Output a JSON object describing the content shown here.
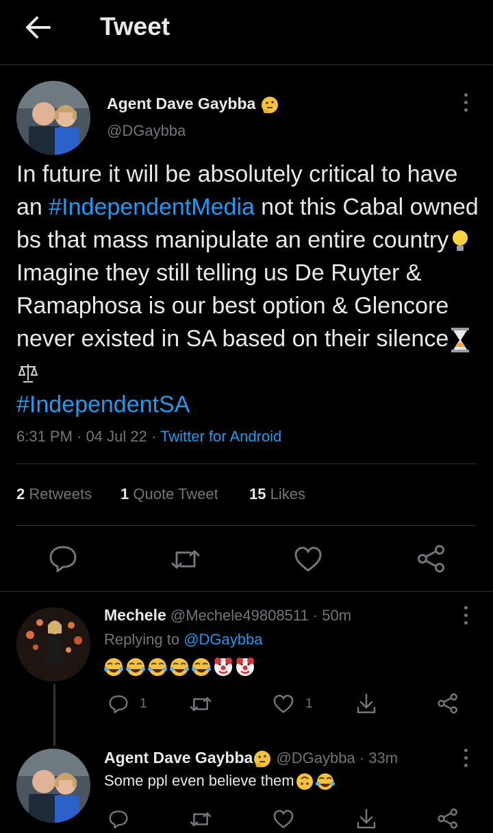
{
  "header": {
    "title": "Tweet"
  },
  "tweet": {
    "author_name": "Agent Dave Gaybba",
    "author_handle": "@DGaybba",
    "text_1": "In future it will be absolutely critical to have an ",
    "hashtag_1": "#IndependentMedia",
    "text_2": " not this Cabal owned bs that mass manipulate an entire country",
    "text_3": " Imagine they still telling us De Ruyter & Ramaphosa is our best option & Glencore never existed in SA based on their silence",
    "hashtag_2": "#IndependentSA",
    "time": "6:31 PM",
    "date": "04 Jul 22",
    "source": "Twitter for Android",
    "retweets_count": "2",
    "retweets_label": "Retweets",
    "quotes_count": "1",
    "quotes_label": "Quote Tweet",
    "likes_count": "15",
    "likes_label": "Likes"
  },
  "replies": [
    {
      "name": "Mechele",
      "handle": "@Mechele49808511",
      "time": "50m",
      "replying_to_label": "Replying to",
      "replying_to_handle": "@DGaybba",
      "reply_count": "1",
      "like_count": "1"
    },
    {
      "name": "Agent Dave Gaybba",
      "handle": "@DGaybba",
      "time": "33m",
      "text": "Some ppl even believe them"
    }
  ],
  "colors": {
    "accent": "#1d9bf0",
    "muted": "#71767b",
    "divider": "#2f3336"
  }
}
